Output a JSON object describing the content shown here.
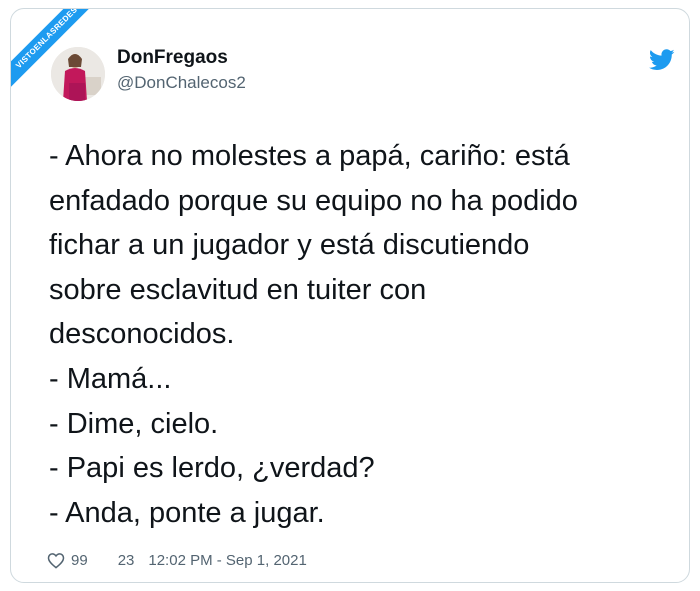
{
  "watermark": {
    "text": "VISTOENLASREDES"
  },
  "author": {
    "name": "DonFregaos",
    "handle": "@DonChalecos2"
  },
  "icons": {
    "brand": "twitter-bird-icon",
    "like": "heart-icon"
  },
  "colors": {
    "brand": "#1d9bf0",
    "text": "#0f1419",
    "muted": "#536471",
    "border": "#cfd9de"
  },
  "tweet": {
    "lines": [
      "- Ahora no molestes a papá, cariño: está",
      "enfadado porque su equipo no ha podido",
      "fichar a un jugador y está discutiendo",
      "sobre esclavitud en tuiter con",
      "desconocidos.",
      "- Mamá...",
      "- Dime, cielo.",
      "- Papi es lerdo, ¿verdad?",
      "- Anda, ponte a jugar."
    ]
  },
  "footer": {
    "likes": "99",
    "retweets": "23",
    "timestamp": "12:02 PM - Sep 1, 2021"
  }
}
